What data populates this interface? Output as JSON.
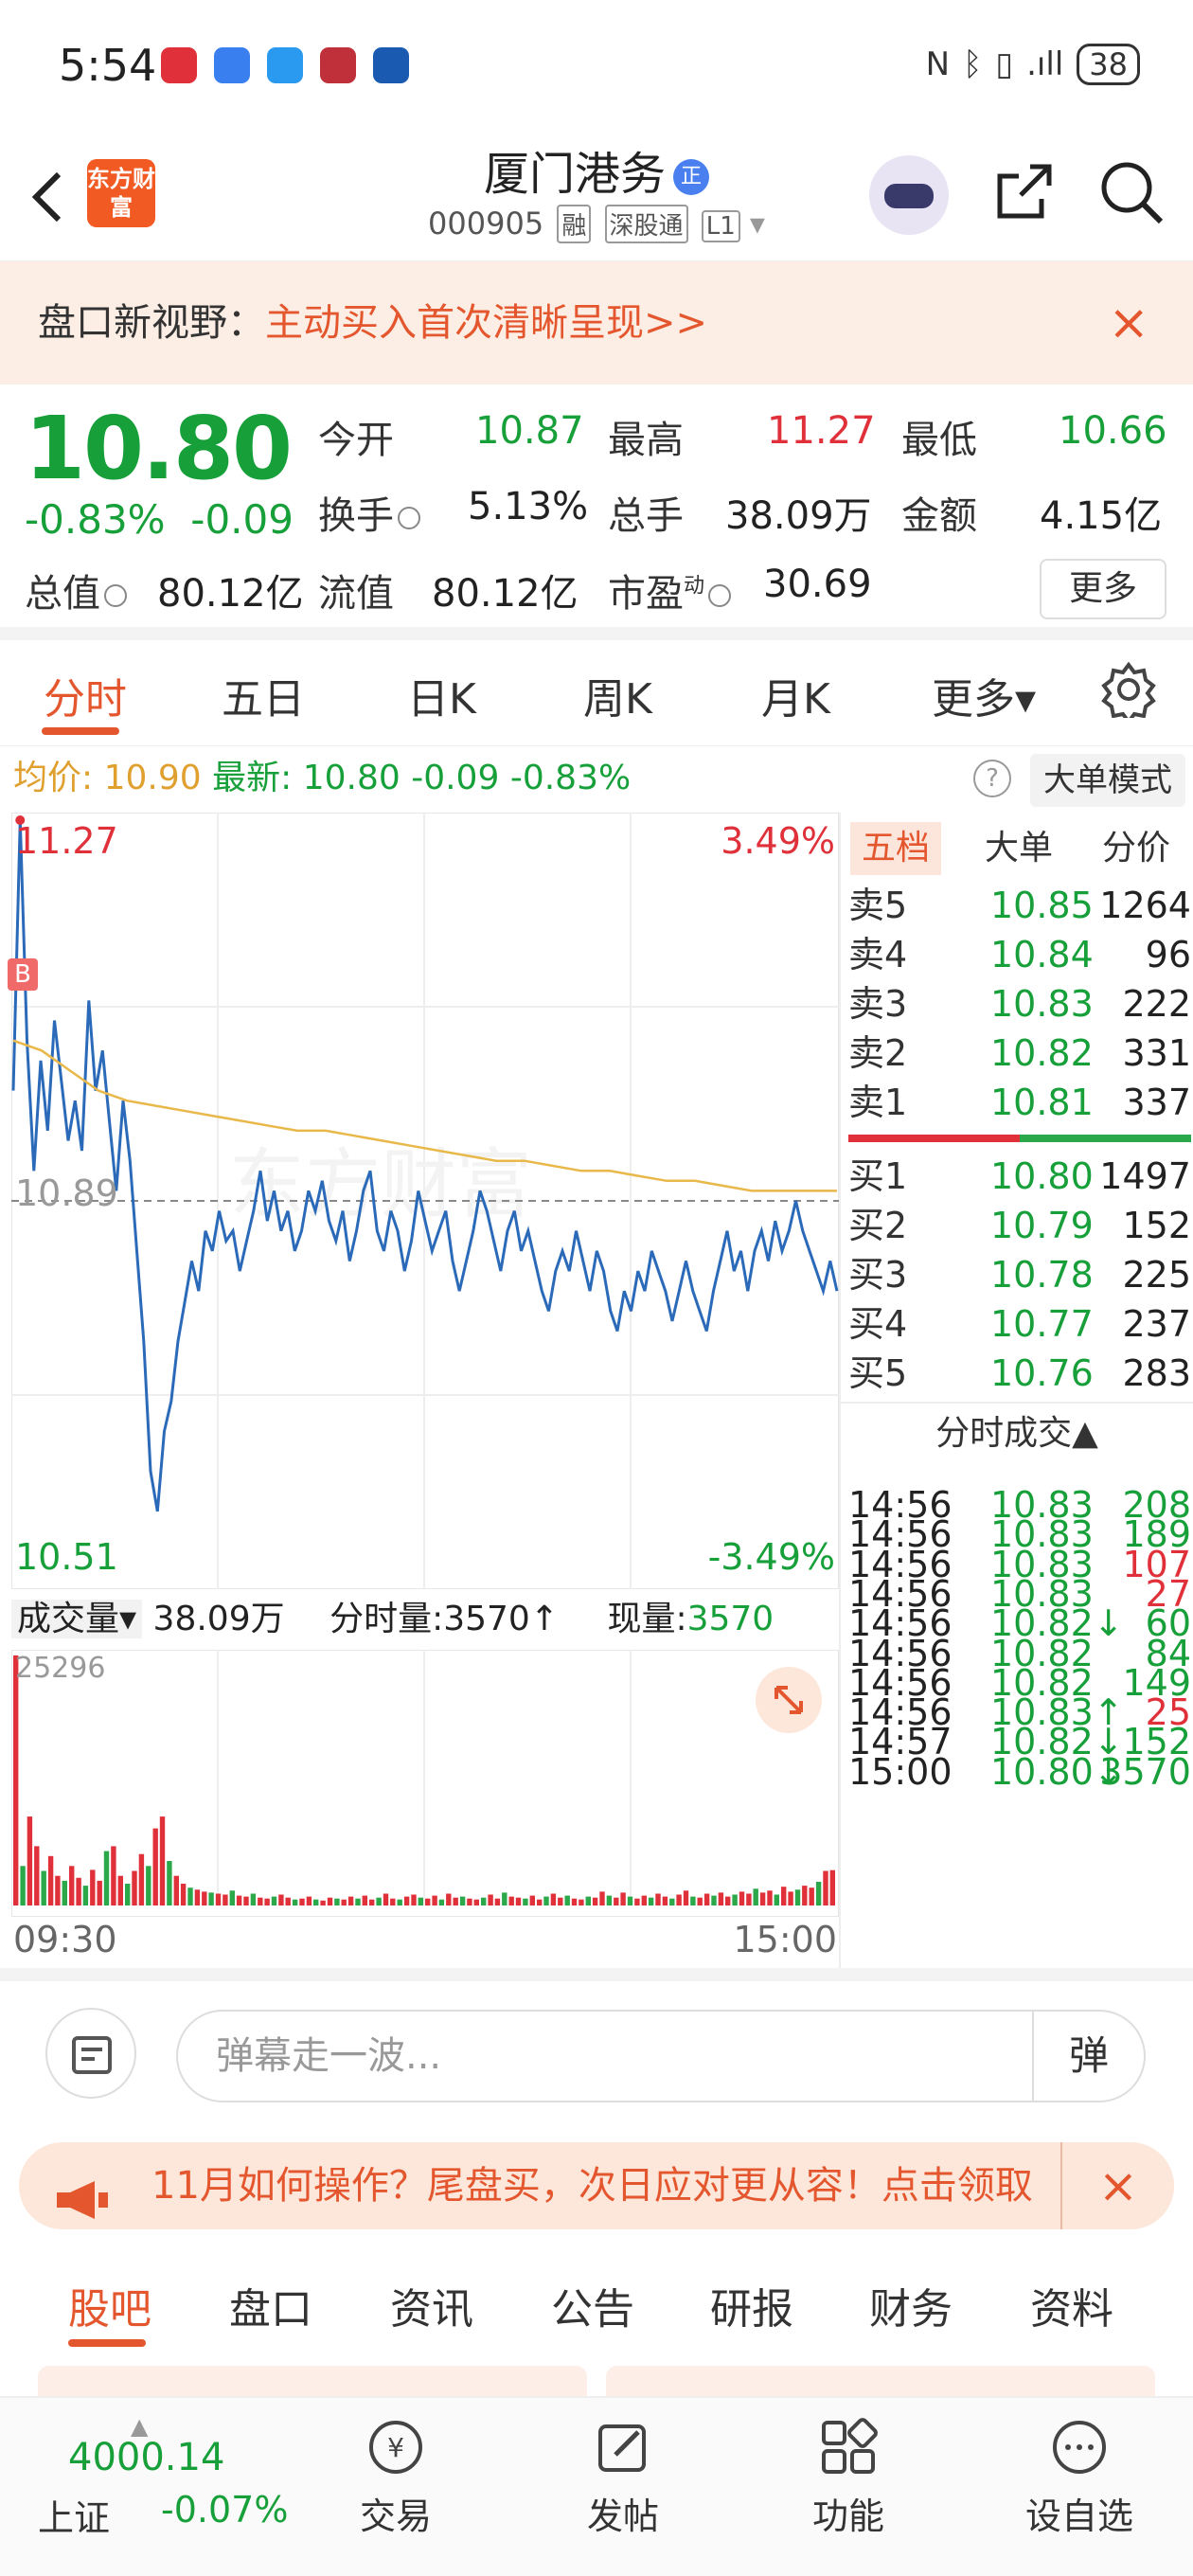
{
  "status_bar": {
    "time": "5:54",
    "battery": "38"
  },
  "header": {
    "back_label": "<",
    "brand": "东方财富",
    "stock_name": "厦门港务",
    "name_badge": "正",
    "stock_code": "000905",
    "tags": [
      "融",
      "深股通",
      "L1"
    ]
  },
  "banner": {
    "prefix": "盘口新视野：",
    "text": "主动买入首次清晰呈现>>",
    "close": "×"
  },
  "quote": {
    "price": "10.80",
    "change_pct": "-0.83%",
    "change": "-0.09",
    "open_label": "今开",
    "open": "10.87",
    "high_label": "最高",
    "high": "11.27",
    "low_label": "最低",
    "low": "10.66",
    "turnover_label": "换手",
    "turnover": "5.13%",
    "volume_label": "总手",
    "volume": "38.09万",
    "amount_label": "金额",
    "amount": "4.15亿",
    "mktcap_label": "总值",
    "mktcap": "80.12亿",
    "float_label": "流值",
    "float_cap": "80.12亿",
    "pe_label": "市盈",
    "pe_sup": "动",
    "pe": "30.69",
    "more_label": "更多"
  },
  "tabs": [
    "分时",
    "五日",
    "日K",
    "周K",
    "月K",
    "更多▾"
  ],
  "info": {
    "avg_label": "均价:",
    "avg": "10.90",
    "latest_label": "最新:",
    "latest": "10.80",
    "chg": "-0.09",
    "pct": "-0.83%",
    "question": "?",
    "mode": "大单模式"
  },
  "chart_labels": {
    "top_price": "11.27",
    "top_pct": "3.49%",
    "mid_price": "10.89",
    "bottom_price": "10.51",
    "bottom_pct": "-3.49%",
    "b_marker": "B",
    "watermark": "东方财富"
  },
  "chart_data": {
    "type": "line",
    "ylim": [
      10.51,
      11.27
    ],
    "ref": 10.89,
    "series": [
      {
        "values": [
          11.0,
          11.27,
          11.05,
          10.92,
          11.03,
          10.96,
          11.07,
          11.01,
          10.95,
          10.99,
          10.94,
          11.09,
          11.0,
          11.04,
          10.97,
          10.9,
          10.99,
          10.93,
          10.84,
          10.75,
          10.62,
          10.58,
          10.66,
          10.69,
          10.75,
          10.79,
          10.83,
          10.8,
          10.86,
          10.84,
          10.88,
          10.85,
          10.86,
          10.82,
          10.85,
          10.88,
          10.92,
          10.87,
          10.9,
          10.86,
          10.88,
          10.84,
          10.86,
          10.9,
          10.88,
          10.91,
          10.87,
          10.85,
          10.88,
          10.83,
          10.86,
          10.9,
          10.92,
          10.86,
          10.84,
          10.88,
          10.86,
          10.82,
          10.85,
          10.9,
          10.87,
          10.84,
          10.86,
          10.88,
          10.83,
          10.8,
          10.83,
          10.86,
          10.9,
          10.88,
          10.85,
          10.82,
          10.86,
          10.88,
          10.84,
          10.86,
          10.83,
          10.8,
          10.78,
          10.82,
          10.84,
          10.82,
          10.86,
          10.83,
          10.8,
          10.84,
          10.82,
          10.78,
          10.76,
          10.8,
          10.78,
          10.82,
          10.8,
          10.84,
          10.82,
          10.8,
          10.77,
          10.8,
          10.83,
          10.8,
          10.78,
          10.76,
          10.8,
          10.83,
          10.86,
          10.82,
          10.84,
          10.8,
          10.84,
          10.86,
          10.83,
          10.87,
          10.84,
          10.86,
          10.89,
          10.86,
          10.84,
          10.82,
          10.8,
          10.83,
          10.8
        ]
      },
      {
        "values": [
          11.05,
          11.04,
          11.02,
          11.0,
          10.99,
          10.985,
          10.98,
          10.975,
          10.97,
          10.965,
          10.96,
          10.96,
          10.955,
          10.95,
          10.945,
          10.94,
          10.935,
          10.93,
          10.93,
          10.925,
          10.92,
          10.92,
          10.915,
          10.91,
          10.91,
          10.905,
          10.9,
          10.9,
          10.9,
          10.9
        ]
      }
    ],
    "x_start": "09:30",
    "x_end": "15:00"
  },
  "order_book": {
    "tabs": [
      "五档",
      "大单",
      "分价"
    ],
    "asks": [
      {
        "l": "卖5",
        "p": "10.85",
        "v": "1264"
      },
      {
        "l": "卖4",
        "p": "10.84",
        "v": "96"
      },
      {
        "l": "卖3",
        "p": "10.83",
        "v": "222"
      },
      {
        "l": "卖2",
        "p": "10.82",
        "v": "331"
      },
      {
        "l": "卖1",
        "p": "10.81",
        "v": "337"
      }
    ],
    "bids": [
      {
        "l": "买1",
        "p": "10.80",
        "v": "1497"
      },
      {
        "l": "买2",
        "p": "10.79",
        "v": "152"
      },
      {
        "l": "买3",
        "p": "10.78",
        "v": "225"
      },
      {
        "l": "买4",
        "p": "10.77",
        "v": "237"
      },
      {
        "l": "买5",
        "p": "10.76",
        "v": "283"
      }
    ],
    "ticks_title": "分时成交▲",
    "ticks": [
      {
        "t": "14:56",
        "p": "10.83",
        "v": "208",
        "c": "g"
      },
      {
        "t": "14:56",
        "p": "10.83",
        "v": "189",
        "c": "g"
      },
      {
        "t": "14:56",
        "p": "10.83",
        "v": "107",
        "c": "r"
      },
      {
        "t": "14:56",
        "p": "10.83",
        "v": "27",
        "c": "r"
      },
      {
        "t": "14:56",
        "p": "10.82↓",
        "v": "60",
        "c": "g"
      },
      {
        "t": "14:56",
        "p": "10.82",
        "v": "84",
        "c": "g"
      },
      {
        "t": "14:56",
        "p": "10.82",
        "v": "149",
        "c": "g"
      },
      {
        "t": "14:56",
        "p": "10.83↑",
        "v": "25",
        "c": "r"
      },
      {
        "t": "14:57",
        "p": "10.82↓",
        "v": "152",
        "c": "g"
      },
      {
        "t": "15:00",
        "p": "10.80↓",
        "v": "3570",
        "c": "g"
      }
    ]
  },
  "volume": {
    "label": "成交量",
    "volume": "38.09万",
    "ftl_label": "分时量:",
    "ftl": "3570↑",
    "cur_label": "现量:",
    "cur": "3570",
    "max": "25296",
    "x_start": "09:30",
    "x_end": "15:00",
    "bars": [
      25296,
      4000,
      9000,
      6000,
      3500,
      5000,
      3000,
      2500,
      4000,
      2800,
      2000,
      3600,
      2500,
      5500,
      6000,
      3000,
      2200,
      3500,
      5200,
      4000,
      7800,
      9000,
      4500,
      3000,
      2200,
      1800,
      1600,
      1400,
      1300,
      1200,
      1100,
      1500,
      1000,
      900,
      1200,
      800,
      700,
      900,
      1100,
      800,
      600,
      700,
      900,
      600,
      500,
      800,
      700,
      600,
      900,
      700,
      1000,
      600,
      800,
      1200,
      700,
      600,
      900,
      1100,
      800,
      700,
      1000,
      600,
      1200,
      800,
      900,
      700,
      600,
      800,
      1100,
      700,
      1300,
      900,
      800,
      700,
      1000,
      600,
      900,
      1200,
      800,
      1000,
      700,
      600,
      900,
      800,
      1400,
      1000,
      800,
      1300,
      900,
      700,
      1000,
      800,
      1200,
      900,
      700,
      1100,
      1500,
      900,
      800,
      1200,
      1000,
      1300,
      900,
      1100,
      1400,
      1200,
      1700,
      1300,
      1500,
      1100,
      1900,
      1400,
      1600,
      2000,
      1800,
      2400,
      3500,
      3570
    ]
  },
  "input": {
    "placeholder": "弹幕走一波...",
    "dan": "弹"
  },
  "notice": {
    "text": "11月如何操作？尾盘买，次日应对更从容！点击领取",
    "close": "×"
  },
  "bottom_tabs": [
    "股吧",
    "盘口",
    "资讯",
    "公告",
    "研报",
    "财务",
    "资料"
  ],
  "bottom_bar": {
    "index_value": "4000.14",
    "index_name": "上证",
    "index_pct": "-0.07%",
    "nav": [
      "交易",
      "发帖",
      "功能",
      "设自选"
    ]
  }
}
